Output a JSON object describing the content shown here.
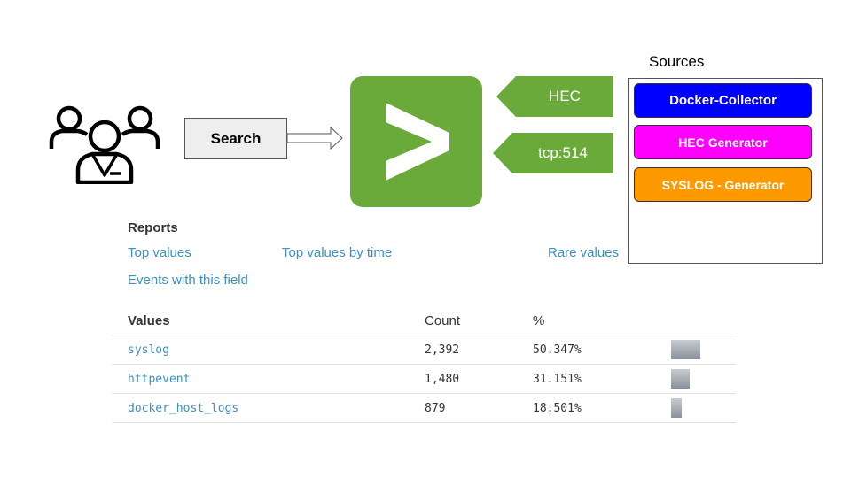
{
  "search": {
    "label": "Search"
  },
  "inputs": [
    {
      "label": "HEC"
    },
    {
      "label": "tcp:514"
    }
  ],
  "sources": {
    "title": "Sources",
    "items": [
      {
        "label": "Docker-Collector",
        "color": "#0000ff"
      },
      {
        "label": "HEC Generator",
        "color": "#ff00ff"
      },
      {
        "label": "SYSLOG - Generator",
        "color": "#ff9900"
      }
    ]
  },
  "colors": {
    "splunk_green": "#6aaa3a",
    "link_blue": "#3c8fc5"
  },
  "reports": {
    "title": "Reports",
    "links": [
      "Top values",
      "Top values by time",
      "Rare values",
      "Events with this field"
    ]
  },
  "values_table": {
    "headers": {
      "values": "Values",
      "count": "Count",
      "percent": "%"
    },
    "rows": [
      {
        "value": "syslog",
        "count": "2,392",
        "percent": "50.347%",
        "fraction": 0.50347
      },
      {
        "value": "httpevent",
        "count": "1,480",
        "percent": "31.151%",
        "fraction": 0.31151
      },
      {
        "value": "docker_host_logs",
        "count": "879",
        "percent": "18.501%",
        "fraction": 0.18501
      }
    ]
  }
}
